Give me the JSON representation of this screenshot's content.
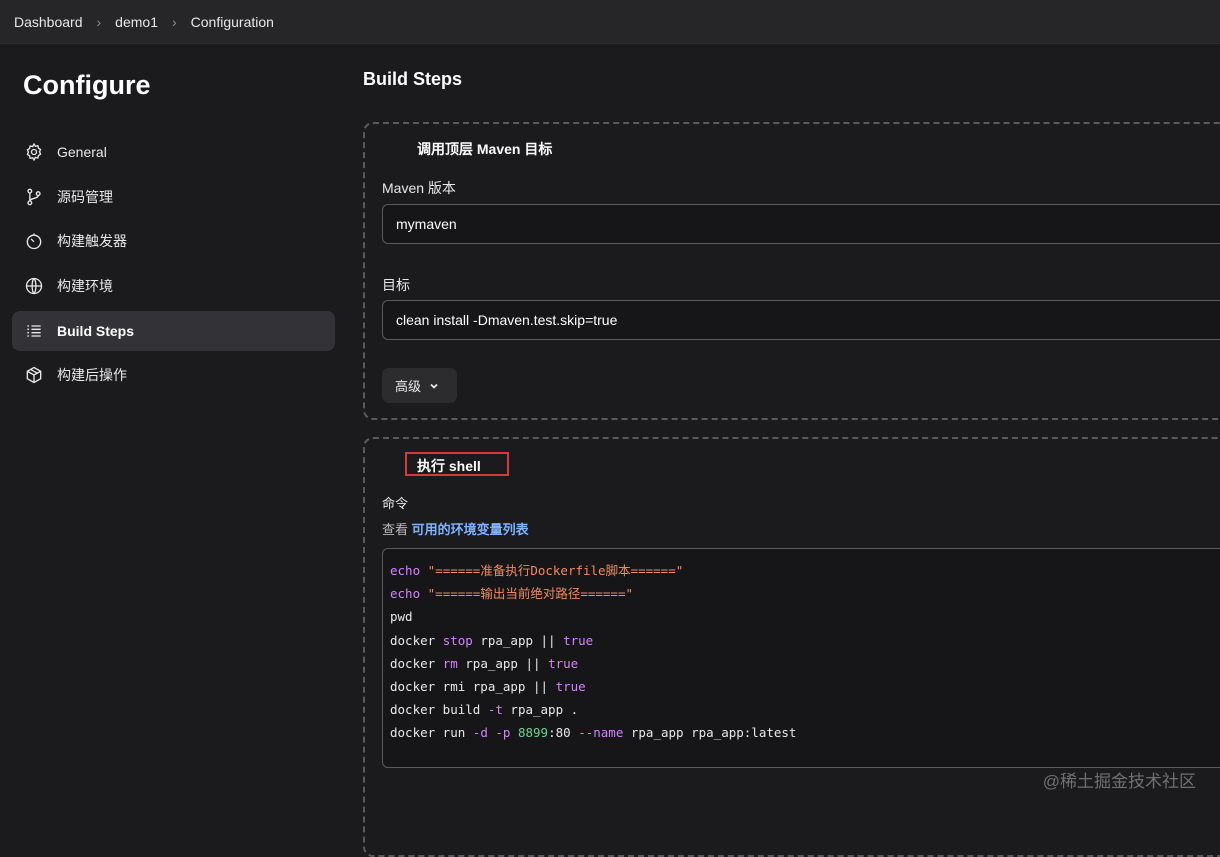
{
  "breadcrumb": [
    "Dashboard",
    "demo1",
    "Configuration"
  ],
  "page_title": "Configure",
  "sidebar": {
    "items": [
      {
        "label": "General",
        "icon": "gear-icon",
        "active": false
      },
      {
        "label": "源码管理",
        "icon": "branch-icon",
        "active": false
      },
      {
        "label": "构建触发器",
        "icon": "timer-icon",
        "active": false
      },
      {
        "label": "构建环境",
        "icon": "globe-icon",
        "active": false
      },
      {
        "label": "Build Steps",
        "icon": "list-icon",
        "active": true
      },
      {
        "label": "构建后操作",
        "icon": "package-icon",
        "active": false
      }
    ]
  },
  "main": {
    "section_title": "Build Steps",
    "maven_step": {
      "title": "调用顶层 Maven 目标",
      "version_label": "Maven 版本",
      "version_value": "mymaven",
      "goals_label": "目标",
      "goals_value": "clean install -Dmaven.test.skip=true",
      "advanced_label": "高级"
    },
    "shell_step": {
      "title": "执行 shell",
      "command_label": "命令",
      "help_prefix": "查看",
      "help_link": "可用的环境变量列表",
      "code_lines": [
        "echo \"======准备执行Dockerfile脚本======\"",
        "echo \"======输出当前绝对路径======\"",
        "pwd",
        "docker stop rpa_app || true",
        "docker rm rpa_app || true",
        "docker rmi rpa_app || true",
        "docker build -t rpa_app .",
        "docker run -d -p 8899:80 --name rpa_app rpa_app:latest"
      ]
    }
  },
  "watermark": "@稀土掘金技术社区",
  "colors": {
    "background": "#1b1b1d",
    "topbar": "#262628",
    "active_nav": "#333337",
    "link": "#7fb2ff",
    "highlight_border": "#d33a3a",
    "keyword": "#d681ff",
    "string": "#f08a64",
    "number": "#6fd38f"
  }
}
